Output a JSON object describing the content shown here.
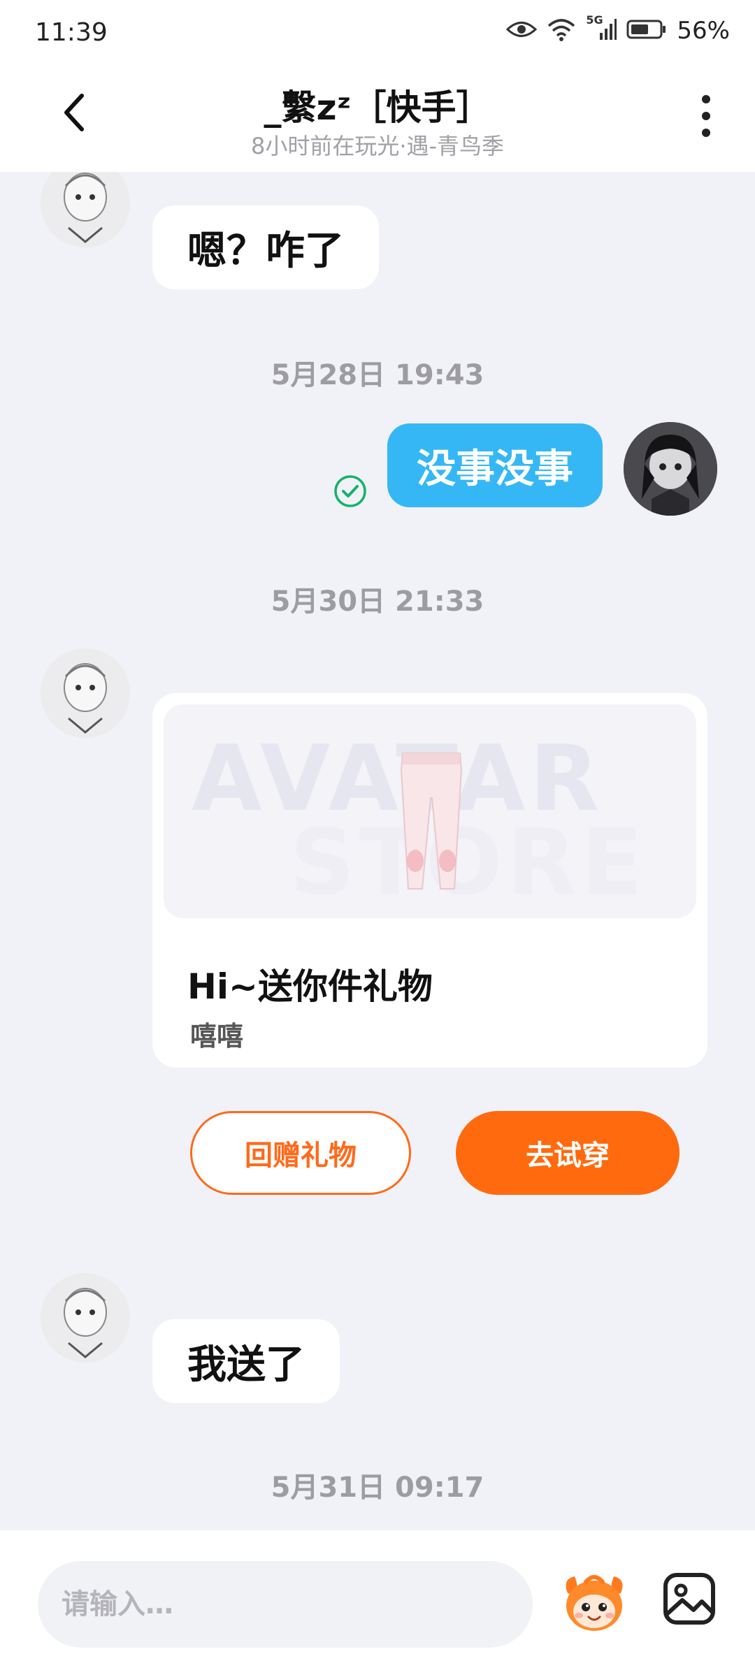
{
  "status_bar": {
    "time": "11:39",
    "network": "5G",
    "battery": "56%"
  },
  "header": {
    "title": "_繫zᶻ［快手］",
    "subtitle": "8小时前在玩光·遇-青鸟季"
  },
  "messages": {
    "m1": "嗯？咋了",
    "t1": "5月28日 19:43",
    "m2": "没事没事",
    "t2": "5月30日 21:33",
    "gift": {
      "watermark_line1": "AVATAR",
      "watermark_line2": "STORE",
      "title": "Hi~送你件礼物",
      "description": "嘻嘻",
      "return_gift_label": "回赠礼物",
      "try_on_label": "去试穿"
    },
    "m3": "我送了",
    "t3": "5月31日 09:17"
  },
  "input": {
    "placeholder": "请输入…"
  },
  "colors": {
    "outgoing_bubble": "#36b7f5",
    "accent": "#ff6a0e",
    "sent_check": "#14b36a"
  }
}
